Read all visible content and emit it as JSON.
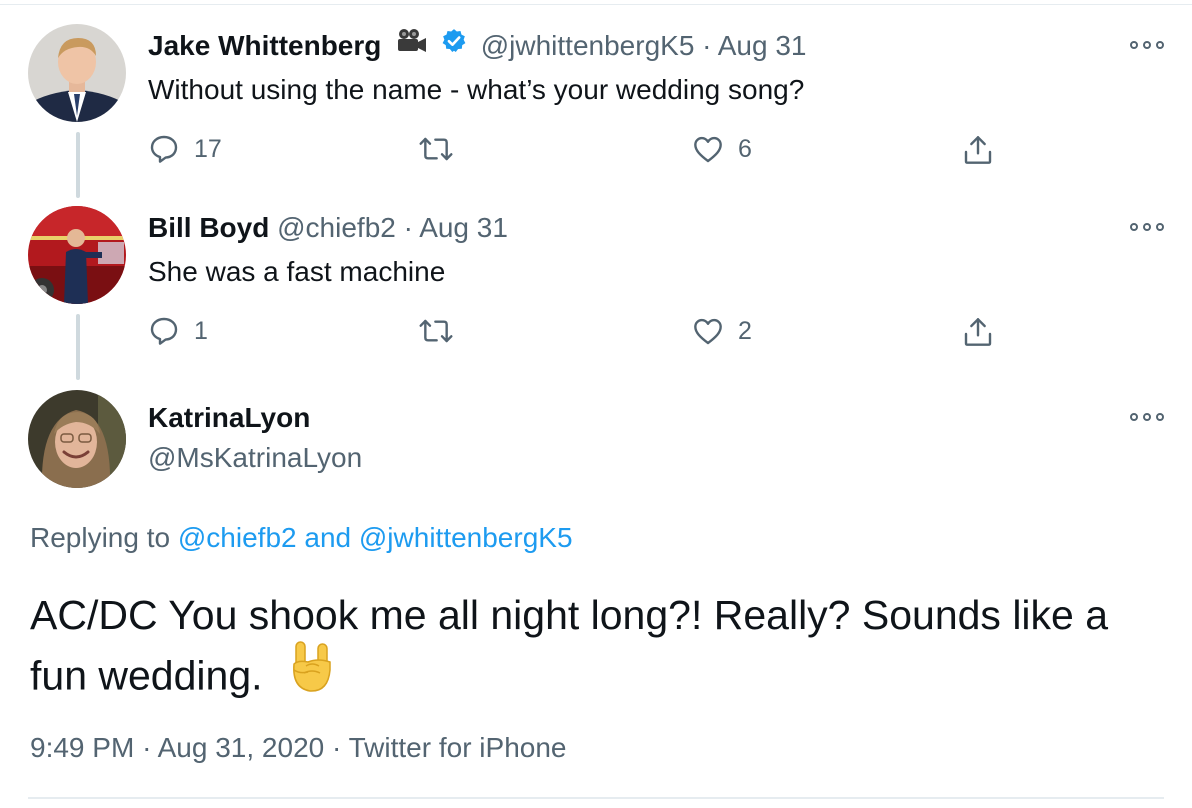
{
  "tweets": [
    {
      "name": "Jake Whittenberg",
      "name_icon": "movie-camera-icon",
      "verified": true,
      "handle": "@jwhittenbergK5",
      "dot": "·",
      "date": "Aug 31",
      "text": "Without using the name - what’s your wedding song?",
      "replies": "17",
      "retweets": "",
      "likes": "6"
    },
    {
      "name": "Bill Boyd",
      "handle": "@chiefb2",
      "dot": "·",
      "date": "Aug 31",
      "text": "She was a fast machine",
      "replies": "1",
      "retweets": "",
      "likes": "2"
    }
  ],
  "main": {
    "name": "KatrinaLyon",
    "handle": "@MsKatrinaLyon",
    "replying_prefix": "Replying to",
    "replying_user1": "@chiefb2",
    "replying_and": "and",
    "replying_user2": "@jwhittenbergK5",
    "text": "AC/DC You shook me all night long?! Really? Sounds like a fun wedding.",
    "emoji": "rock-on-hand-emoji",
    "time": "9:49 PM",
    "dot": "·",
    "date": "Aug 31, 2020",
    "source": "Twitter for iPhone"
  },
  "colors": {
    "link": "#1d9bf0",
    "muted": "#536471",
    "text": "#0f1419",
    "verified": "#1d9bf0",
    "emoji": "#f7c948"
  }
}
